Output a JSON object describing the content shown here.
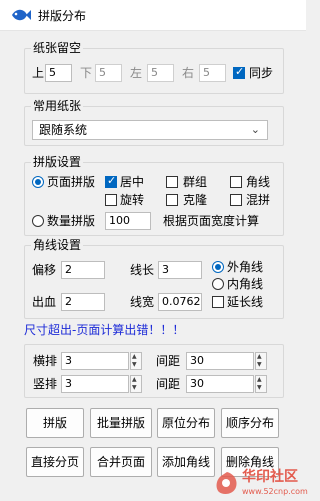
{
  "window": {
    "title": "拼版分布"
  },
  "paper_margin": {
    "legend": "纸张留空",
    "top": {
      "label": "上",
      "value": "5"
    },
    "bottom": {
      "label": "下",
      "value": "5"
    },
    "left": {
      "label": "左",
      "value": "5"
    },
    "right": {
      "label": "右",
      "value": "5"
    },
    "sync": {
      "label": "同步",
      "checked": true
    }
  },
  "common_paper": {
    "legend": "常用纸张",
    "selected": "跟随系统"
  },
  "layout": {
    "legend": "拼版设置",
    "page_layout": {
      "label": "页面拼版",
      "selected": true
    },
    "center": {
      "label": "居中",
      "checked": true
    },
    "group": {
      "label": "群组",
      "checked": false
    },
    "crop_marks": {
      "label": "角线",
      "checked": false
    },
    "rotate": {
      "label": "旋转",
      "checked": false
    },
    "clone": {
      "label": "克隆",
      "checked": false
    },
    "mixed": {
      "label": "混拼",
      "checked": false
    },
    "qty_layout": {
      "label": "数量拼版",
      "selected": false
    },
    "qty_value": "100",
    "width_note": "根据页面宽度计算"
  },
  "corner": {
    "legend": "角线设置",
    "offset": {
      "label": "偏移",
      "value": "2"
    },
    "length": {
      "label": "线长",
      "value": "3"
    },
    "bleed": {
      "label": "出血",
      "value": "2"
    },
    "width": {
      "label": "线宽",
      "value": "0.0762"
    },
    "outer": {
      "label": "外角线",
      "selected": true
    },
    "inner": {
      "label": "内角线",
      "selected": false
    },
    "extend": {
      "label": "延长线",
      "checked": false
    }
  },
  "error_message": "尺寸超出-页面计算出错！！！",
  "grid": {
    "cols": {
      "label": "横排",
      "value": "3"
    },
    "col_gap": {
      "label": "间距",
      "value": "30"
    },
    "rows": {
      "label": "竖排",
      "value": "3"
    },
    "row_gap": {
      "label": "间距",
      "value": "30"
    }
  },
  "buttons": {
    "impose": "拼版",
    "batch_impose": "批量拼版",
    "in_place": "原位分布",
    "sequential": "顺序分布",
    "direct_paging": "直接分页",
    "merge_pages": "合并页面",
    "add_marks": "添加角线",
    "delete_marks": "删除角线"
  },
  "watermark": {
    "text": "华印社区",
    "url": "www.52cnp.com"
  },
  "colors": {
    "accent": "#0067c0",
    "error": "#1d2bd7",
    "watermark": "#e35b4e"
  }
}
